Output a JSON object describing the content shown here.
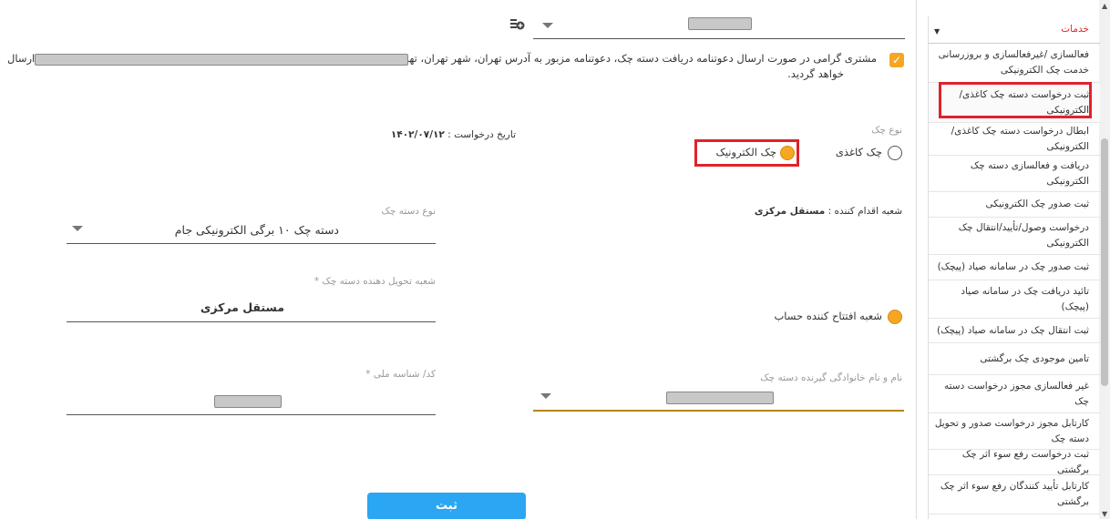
{
  "top_select": {
    "value": "[redacted]"
  },
  "notice": {
    "checked": true,
    "line1": "مشتری گرامی در صورت ارسال دعوتنامه دریافت دسته چک، دعوتنامه مزبور به آدرس تهران، شهر تهران، تهران، مرکزی،",
    "line1_end": "ارسال",
    "line2": "خواهد گردید."
  },
  "check_type": {
    "label": "نوع چک",
    "options": [
      {
        "label": "چک کاغذی",
        "selected": false
      },
      {
        "label": "چک الکترونیک",
        "selected": true
      }
    ]
  },
  "request_date": {
    "label": "تاریخ درخواست :",
    "value": "۱۴۰۲/۰۷/۱۲"
  },
  "branch_action": {
    "label": "شعبه اقدام کننده :",
    "value": "مستقل مرکزی"
  },
  "checkbook_type": {
    "label": "نوع دسته چک",
    "value": "دسته چک ۱۰ برگی الکترونیکی جام"
  },
  "delivery_branch": {
    "label": "شعبه تحویل دهنده دسته چک *",
    "value": "مستقل مرکزی"
  },
  "account_branch": {
    "label": "شعبه افتتاح کننده حساب"
  },
  "national_id": {
    "label": "کد/ شناسه ملی *"
  },
  "receiver_name": {
    "label": "نام و نام خانوادگی گیرنده دسته چک"
  },
  "submit_label": "ثبت",
  "sidebar": {
    "header": "خدمات",
    "items": [
      "فعالسازی /غیرفعالسازی و بروزرسانی خدمت چک الکترونیکی",
      "ثبت درخواست دسته چک کاغذی/ الکترونیکی",
      "ابطال درخواست دسته چک کاغذی/ الکترونیکی",
      "دریافت و فعالسازی دسته چک الکترونیکی",
      "ثبت صدور چک الکترونیکی",
      "درخواست وصول/تأیید/انتقال چک الکترونیکی",
      "ثبت صدور چک در سامانه صیاد (پیچک)",
      "تائید دریافت چک در سامانه صیاد (پیچک)",
      "ثبت انتقال چک در سامانه صیاد (پیچک)",
      "تامین موجودی چک برگشتی",
      "غیر فعالسازی مجوز درخواست دسته چک",
      "کارتابل مجوز درخواست صدور و تحویل دسته چک",
      "ثبت درخواست رفع سوء اثر چک برگشتی",
      "کارتابل تأیید کنندگان رفع سوء اثر چک برگشتی"
    ]
  }
}
